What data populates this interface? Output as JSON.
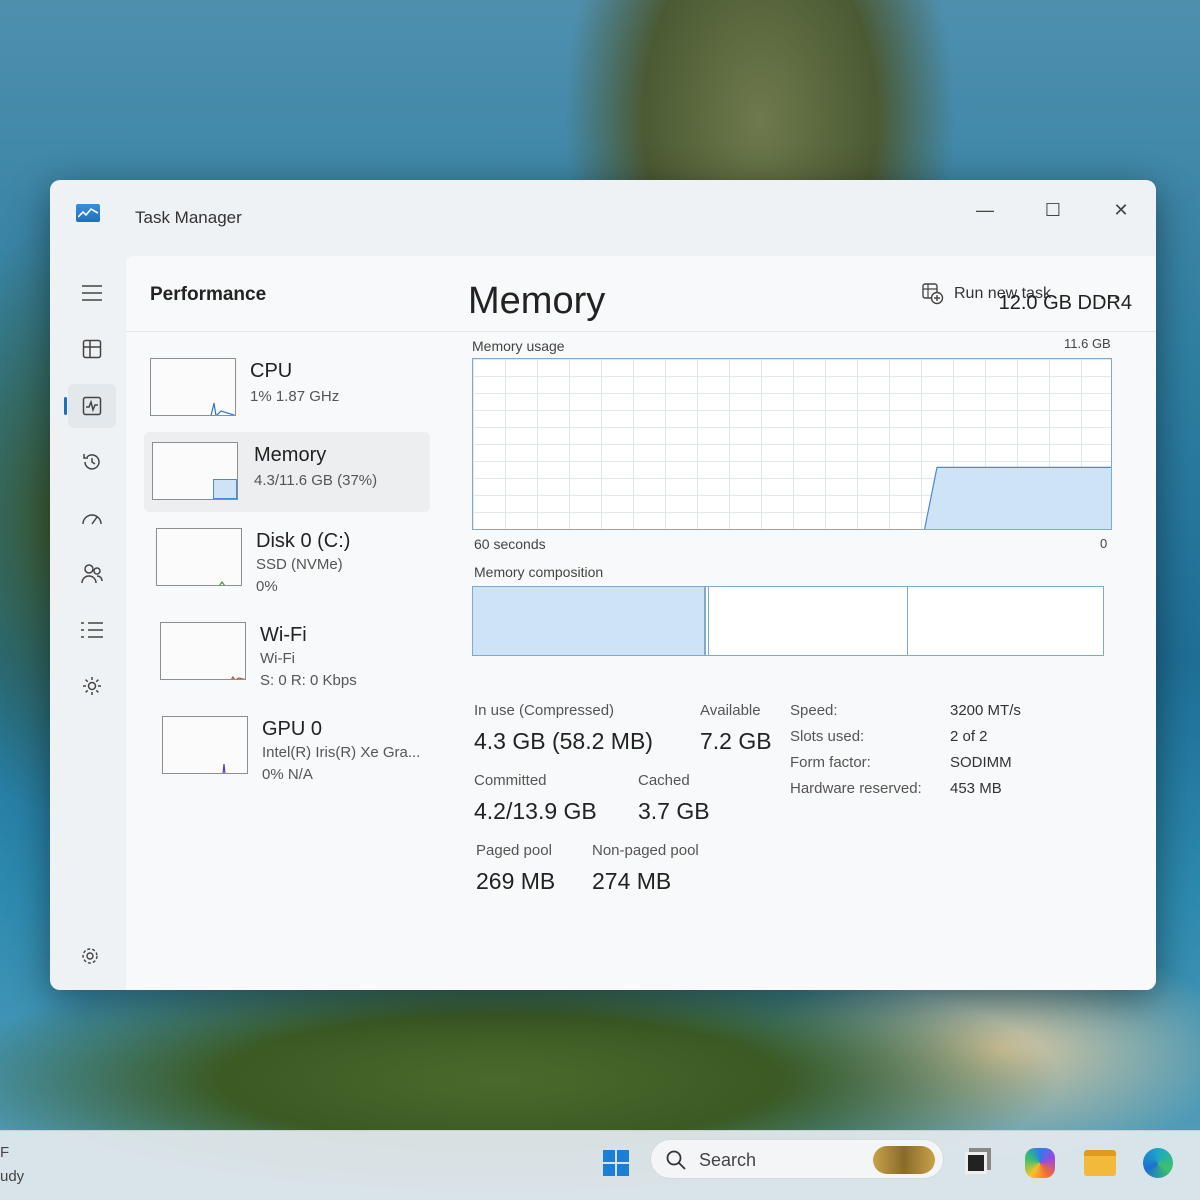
{
  "window": {
    "title": "Task Manager",
    "controls": {
      "minimize": "—",
      "maximize": "☐",
      "close": "✕"
    }
  },
  "header": {
    "page_title": "Performance",
    "run_task_label": "Run new task",
    "more_label": "..."
  },
  "nav": {
    "items": [
      "menu-icon",
      "processes-icon",
      "performance-icon",
      "app-history-icon",
      "startup-apps-icon",
      "users-icon",
      "details-icon",
      "services-icon"
    ],
    "active": "performance-icon",
    "settings": "settings-icon"
  },
  "devices": [
    {
      "name": "CPU",
      "line1": "1% 1.87 GHz",
      "line2": ""
    },
    {
      "name": "Memory",
      "line1": "4.3/11.6 GB (37%)",
      "line2": ""
    },
    {
      "name": "Disk 0 (C:)",
      "line1": "SSD (NVMe)",
      "line2": "0%"
    },
    {
      "name": "Wi-Fi",
      "line1": "Wi-Fi",
      "line2": "S: 0 R: 0 Kbps"
    },
    {
      "name": "GPU 0",
      "line1": "Intel(R) Iris(R) Xe Gra...",
      "line2": "0% N/A"
    }
  ],
  "memory": {
    "title": "Memory",
    "spec": "12.0 GB DDR4",
    "usage_label": "Memory usage",
    "usage_max": "11.6 GB",
    "time_left": "60 seconds",
    "time_right": "0",
    "usage_fraction": 0.37,
    "composition_label": "Memory composition",
    "composition_fractions": {
      "in_use": 0.37,
      "modified": 0.005,
      "standby": 0.315,
      "free": 0.31
    },
    "stats": {
      "in_use_label": "In use (Compressed)",
      "in_use_value": "4.3 GB (58.2 MB)",
      "available_label": "Available",
      "available_value": "7.2 GB",
      "committed_label": "Committed",
      "committed_value": "4.2/13.9 GB",
      "cached_label": "Cached",
      "cached_value": "3.7 GB",
      "paged_label": "Paged pool",
      "paged_value": "269 MB",
      "nonpaged_label": "Non-paged pool",
      "nonpaged_value": "274 MB"
    },
    "props": [
      {
        "key": "Speed:",
        "value": "3200 MT/s"
      },
      {
        "key": "Slots used:",
        "value": "2 of 2"
      },
      {
        "key": "Form factor:",
        "value": "SODIMM"
      },
      {
        "key": "Hardware reserved:",
        "value": "453 MB"
      }
    ]
  },
  "taskbar": {
    "weather_line1": "F",
    "weather_line2": "udy",
    "search_placeholder": "Search"
  },
  "colors": {
    "accent": "#1f6fbf",
    "graph_border": "#7fa9cf",
    "graph_fill": "#cfe3f6"
  }
}
